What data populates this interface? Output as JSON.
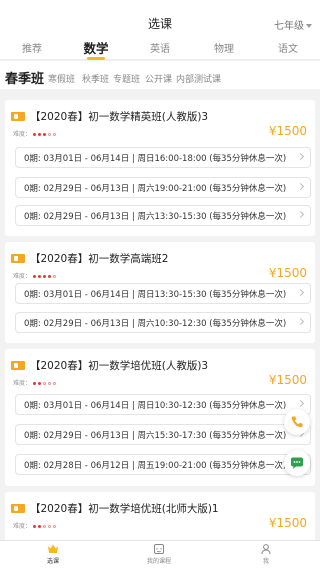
{
  "header": {
    "title": "选课",
    "grade": "七年级"
  },
  "subjects": [
    "推荐",
    "数学",
    "英语",
    "物理",
    "语文"
  ],
  "class_types": [
    "春季班",
    "寒假班",
    "秋季班",
    "专题班",
    "公开课",
    "内部测试课"
  ],
  "courses": [
    {
      "title": "【2020春】初一数学精英班(人教版)3",
      "difficulty_label": "难度：",
      "difficulty": 3,
      "price": "¥1500",
      "sessions": [
        "0期: 03月01日 - 06月14日 | 周日16:00-18:00 (每35分钟休息一次)",
        "0期: 02月29日 - 06月13日 | 周六19:00-21:00 (每35分钟休息一次)",
        "0期: 02月29日 - 06月13日 | 周六13:30-15:30 (每35分钟休息一次)"
      ]
    },
    {
      "title": "【2020春】初一数学高端班2",
      "difficulty_label": "难度：",
      "difficulty": 4,
      "price": "¥1500",
      "sessions": [
        "0期: 03月01日 - 06月14日 | 周日13:30-15:30 (每35分钟休息一次)",
        "0期: 02月29日 - 06月13日 | 周六10:30-12:30 (每35分钟休息一次)"
      ]
    },
    {
      "title": "【2020春】初一数学培优班(人教版)3",
      "difficulty_label": "难度：",
      "difficulty": 2,
      "price": "¥1500",
      "sessions": [
        "0期: 03月01日 - 06月14日 | 周日10:30-12:30 (每35分钟休息一次)",
        "0期: 02月29日 - 06月13日 | 周六15:30-17:30 (每35分钟休息一次)",
        "0期: 02月28日 - 06月12日 | 周五19:00-21:00 (每35分钟休息一次)"
      ]
    },
    {
      "title": "【2020春】初一数学培优班(北师大版)1",
      "difficulty_label": "难度：",
      "difficulty": 2,
      "price": "¥1500",
      "sessions": []
    }
  ],
  "tabbar": [
    "选课",
    "我的课程",
    "我"
  ],
  "colors": {
    "accent": "#f7b81d",
    "price": "#f5a623",
    "star": "#e53935",
    "fab_icon": "#f5a623",
    "chat_icon": "#2e9e4f"
  },
  "icons": {
    "phone": "phone-icon",
    "chat": "chat-icon",
    "courses_tab": "crown-icon",
    "mycourse_tab": "book-icon",
    "me_tab": "person-icon"
  }
}
